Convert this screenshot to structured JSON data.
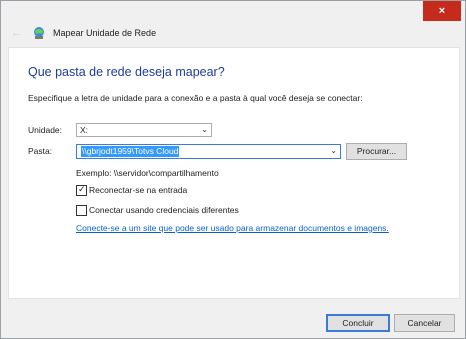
{
  "window": {
    "title": "Mapear Unidade de Rede",
    "close_glyph": "×"
  },
  "dialog": {
    "heading": "Que pasta de rede deseja mapear?",
    "description": "Especifique a letra de unidade para a conexão e a pasta à qual você deseja se conectar:",
    "drive": {
      "label": "Unidade:",
      "value": "X:"
    },
    "folder": {
      "label": "Pasta:",
      "value": "\\\\gbrjodt1959\\Totvs Cloud"
    },
    "browse_label": "Procurar...",
    "example": "Exemplo: \\\\servidor\\compartilhamento",
    "reconnect": {
      "label": "Reconectar-se na entrada",
      "checked": true
    },
    "credentials": {
      "label": "Conectar usando credenciais diferentes",
      "checked": false
    },
    "link_text": "Conecte-se a um site que pode ser usado para armazenar documentos e imagens."
  },
  "footer": {
    "ok_label": "Concluir",
    "cancel_label": "Cancelar"
  },
  "icons": {
    "back": "arrow-left-icon",
    "app": "network-drive-icon",
    "check": "checkmark-icon"
  },
  "colors": {
    "heading": "#1f3c9a",
    "link": "#0b60c8",
    "close": "#c42b1c",
    "selection": "#3399ff"
  }
}
